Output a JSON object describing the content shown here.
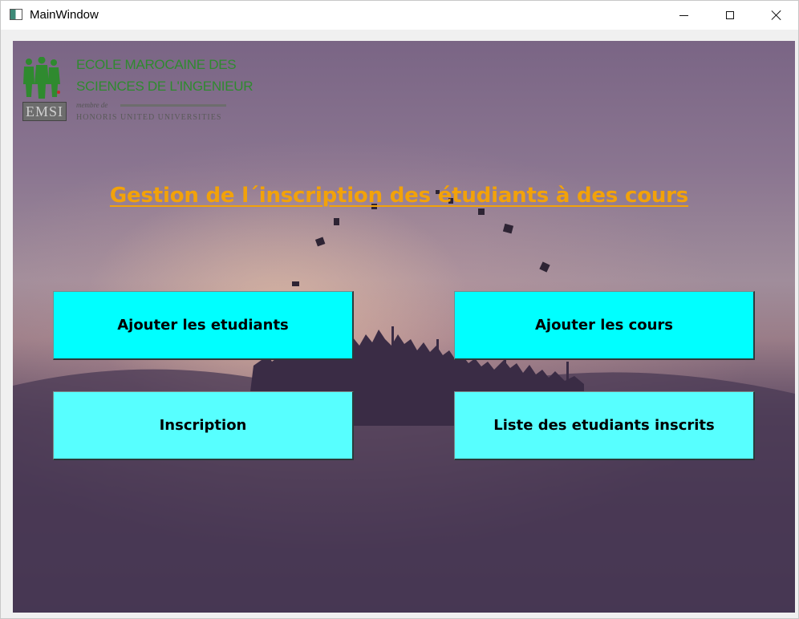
{
  "window": {
    "title": "MainWindow"
  },
  "logo": {
    "line1": "ECOLE MAROCAINE DES",
    "line2": "SCIENCES DE L'INGENIEUR",
    "member": "membre de",
    "brand": "HONORIS UNITED UNIVERSITIES",
    "badge": "EMSI"
  },
  "heading": "Gestion de l´inscription des étudiants à des cours",
  "buttons": {
    "add_students": "Ajouter les etudiants",
    "add_courses": "Ajouter les cours",
    "inscription": "Inscription",
    "enrolled_list": "Liste des etudiants inscrits"
  },
  "colors": {
    "heading": "#f2a20a",
    "button_primary": "#00ffff",
    "button_secondary": "#57ffff",
    "logo_green": "#2f8a2f"
  }
}
